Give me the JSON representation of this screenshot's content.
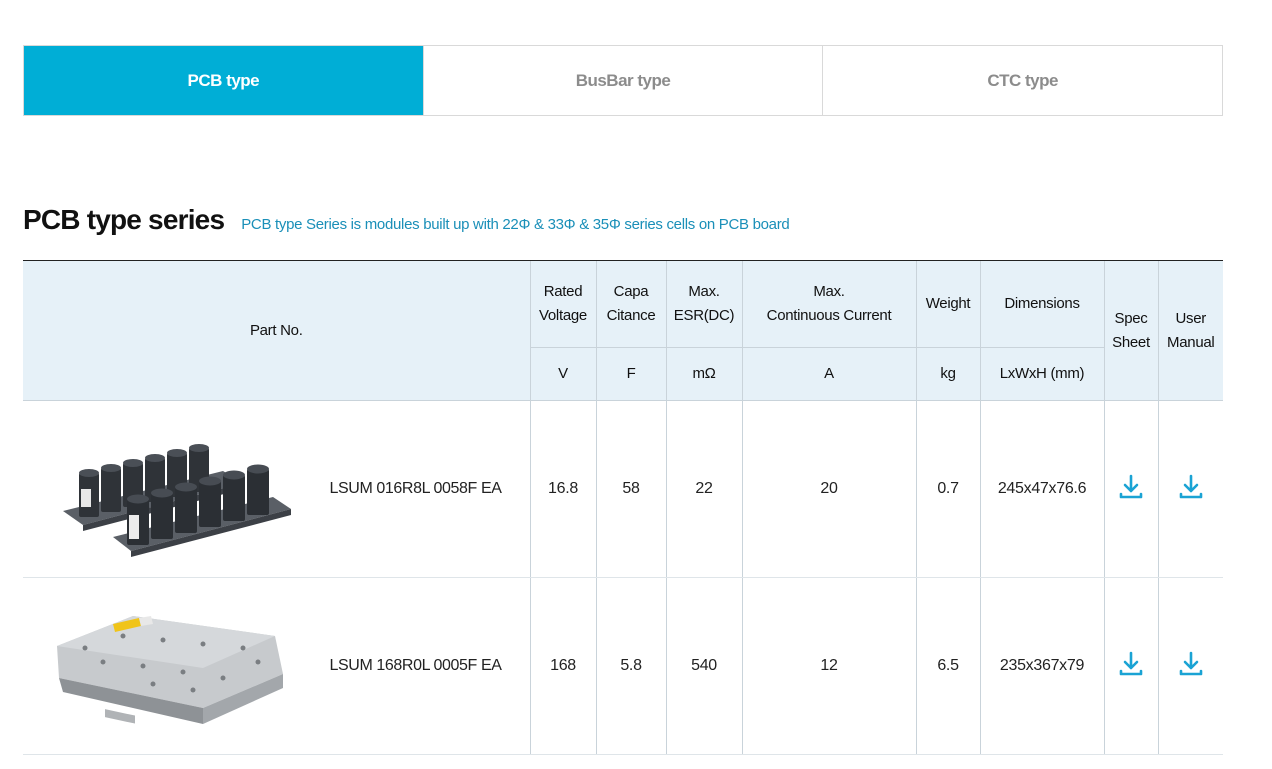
{
  "tabs": [
    {
      "label": "PCB type",
      "active": true
    },
    {
      "label": "BusBar type",
      "active": false
    },
    {
      "label": "CTC type",
      "active": false
    }
  ],
  "section": {
    "title": "PCB type series",
    "description": "PCB type Series is modules built up with 22Φ & 33Φ & 35Φ series cells on PCB board"
  },
  "table": {
    "headers": {
      "part_no": "Part No.",
      "rated_voltage_1": "Rated",
      "rated_voltage_2": "Voltage",
      "capacitance_1": "Capa",
      "capacitance_2": "Citance",
      "esr_1": "Max.",
      "esr_2": "ESR(DC)",
      "current_1": "Max.",
      "current_2": "Continuous Current",
      "weight": "Weight",
      "dimensions": "Dimensions",
      "spec_1": "Spec",
      "spec_2": "Sheet",
      "manual_1": "User",
      "manual_2": "Manual"
    },
    "units": {
      "voltage": "V",
      "capacitance": "F",
      "esr": "mΩ",
      "current": "A",
      "weight": "kg",
      "dimensions": "LxWxH (mm)"
    },
    "rows": [
      {
        "part_no": "LSUM 016R8L 0058F EA",
        "voltage": "16.8",
        "capacitance": "58",
        "esr": "22",
        "current": "20",
        "weight": "0.7",
        "dimensions": "245x47x76.6",
        "image": "capacitor-module-cylinders"
      },
      {
        "part_no": "LSUM 168R0L 0005F EA",
        "voltage": "168",
        "capacitance": "5.8",
        "esr": "540",
        "current": "12",
        "weight": "6.5",
        "dimensions": "235x367x79",
        "image": "capacitor-module-box"
      }
    ]
  },
  "colors": {
    "accent": "#00aed6",
    "header_bg": "#e6f1f8",
    "description": "#1a8fb8",
    "download_icon": "#1aa3d4"
  },
  "icons": {
    "download": "download-icon"
  }
}
